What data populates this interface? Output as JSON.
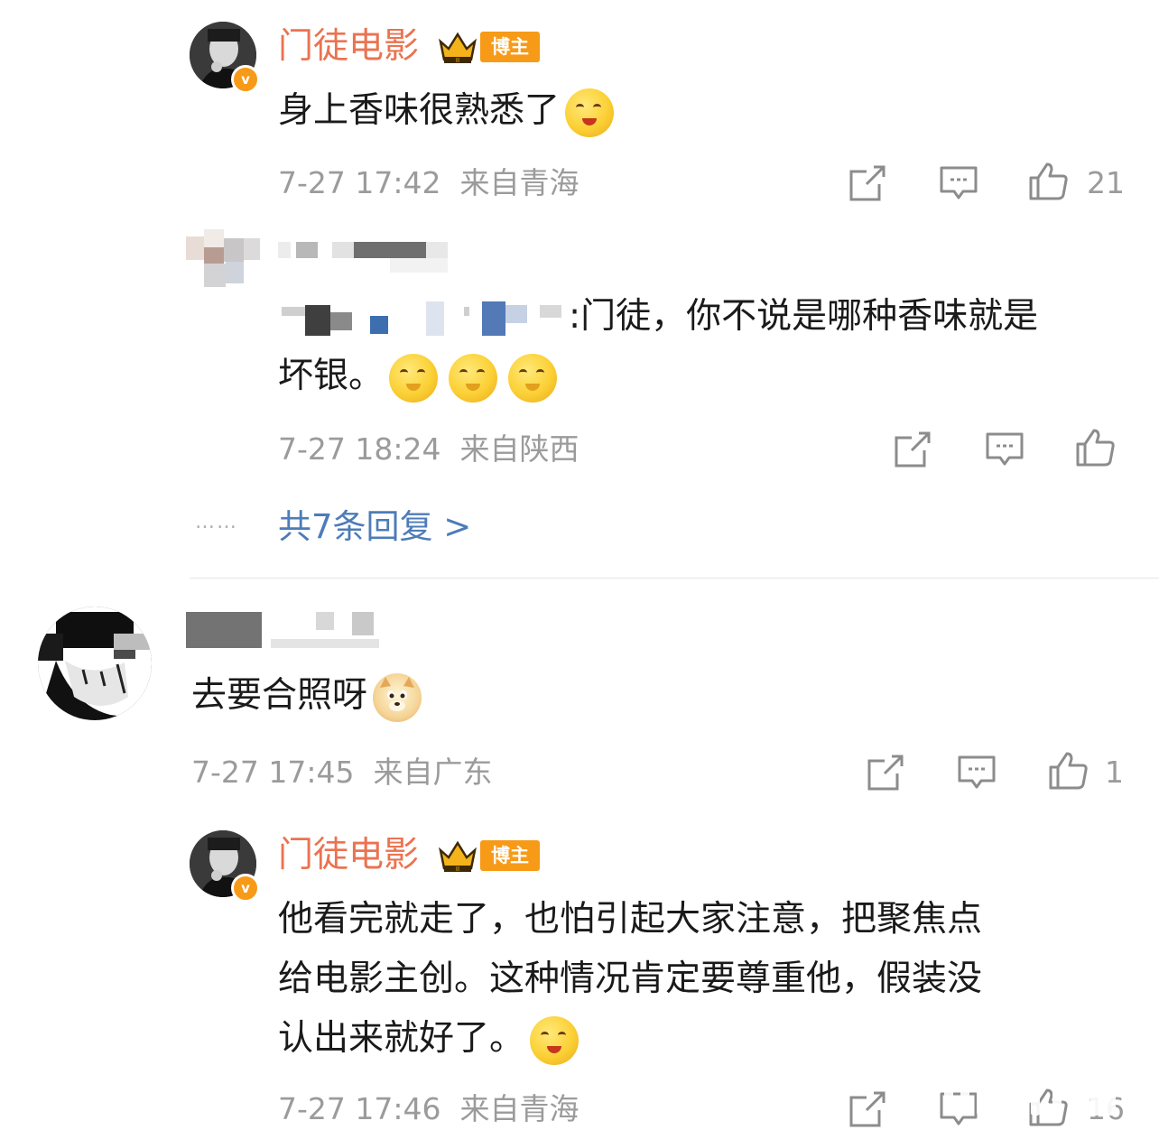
{
  "comments": [
    {
      "author": "门徒电影",
      "badge": "博主",
      "text": "身上香味很熟悉了",
      "time": "7-27 17:42",
      "location": "来自青海",
      "likes": "21"
    },
    {
      "author": "",
      "text_line1": ":门徒，你不说是哪种香味就是",
      "text_line2": "坏银。",
      "time": "7-27 18:24",
      "location": "来自陕西",
      "likes": ""
    }
  ],
  "more_replies": "共7条回复 >",
  "dots": "……",
  "comment2": {
    "text": "去要合照呀",
    "time": "7-27 17:45",
    "location": "来自广东",
    "likes": "1"
  },
  "comment3": {
    "author": "门徒电影",
    "badge": "博主",
    "text_line1": "他看完就走了，也怕引起大家注意，把聚焦点",
    "text_line2": "给电影主创。这种情况肯定要尊重他，假装没",
    "text_line3": "认出来就好了。",
    "time": "7-27 17:46",
    "location": "来自青海",
    "likes": "16"
  },
  "colors": {
    "name_orange": "#eb7350",
    "link_blue": "#4d7cb8",
    "meta_gray": "#9b9b9b",
    "badge_orange": "#f79a17"
  },
  "icons": [
    "share-icon",
    "comment-icon",
    "like-icon",
    "crown-icon",
    "verified-icon"
  ]
}
